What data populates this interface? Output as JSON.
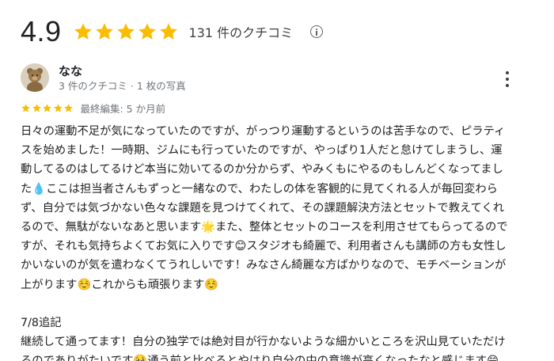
{
  "summary": {
    "rating": "4.9",
    "stars": 5,
    "count_label": "131 件のクチコミ",
    "star_color": "#fbbc04",
    "info_icon": "info-icon"
  },
  "review": {
    "reviewer_name": "なな",
    "reviewer_meta": "3 件のクチコミ · 1 枚の写真",
    "rating": 5,
    "edited_label": "最終編集: 5 か月前",
    "more_icon": "more-vert-icon",
    "text": "日々の運動不足が気になっていたのですが、がっつり運動するというのは苦手なので、ピラティスを始めました！一時期、ジムにも行っていたのですが、やっぱり1人だと怠けてしまうし、運動してるのはしてるけど本当に効いてるのか分からず、やみくもにやるのもしんどくなってました💧ここは担当者さんもずっと一緒なので、わたしの体を客観的に見てくれる人が毎回変わらず、自分では気づかない色々な課題を見つけてくれて、その課題解決方法とセットで教えてくれるので、無駄がないなあと思います🌟また、整体とセットのコースを利用させてもらってるのですが、それも気持ちよくてお気に入りです😊スタジオも綺麗で、利用者さんも講師の方も女性しかいないのが気を遣わなくてうれしいです！みなさん綺麗な方ばかりなので、モチベーションが上がります☺️これからも頑張ります☺️\n\n7/8追記\n継続して通ってます！自分の独学では絶対目が行かないような細かいところを沢山見ていただけるのでありがたいです🥹通う前と比べるとやはり自分の中の意識が高くなったなと感じます😄"
  }
}
